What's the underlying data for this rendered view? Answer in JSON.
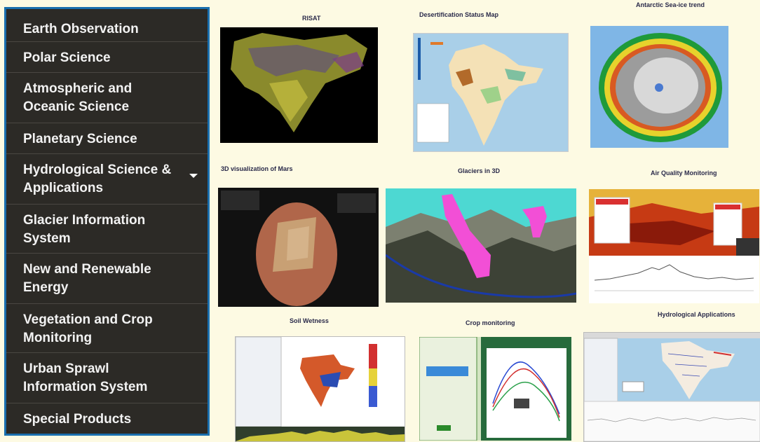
{
  "menu": [
    "Earth Observation",
    "Polar Science",
    "Atmospheric and Oceanic Science",
    "Planetary Science",
    "Hydrological Science & Applications",
    "Glacier Information System",
    "New and Renewable Energy",
    "Vegetation and Crop Monitoring",
    "Urban Sprawl Information System",
    "Special Products"
  ],
  "tiles": {
    "risat": "RISAT",
    "desertification": "Desertification Status Map",
    "antarctic": "Antarctic Sea-ice trend",
    "mars": "3D visualization of Mars",
    "glaciers": "Glaciers in 3D",
    "air_quality": "Air Quality Monitoring",
    "soil": "Soil Wetness",
    "crop": "Crop monitoring",
    "hydro": "Hydrological Applications"
  },
  "colors": {
    "sidebar_bg": "#2c2a26",
    "sidebar_border": "#1a6fae",
    "page_bg": "#fdfae3"
  }
}
